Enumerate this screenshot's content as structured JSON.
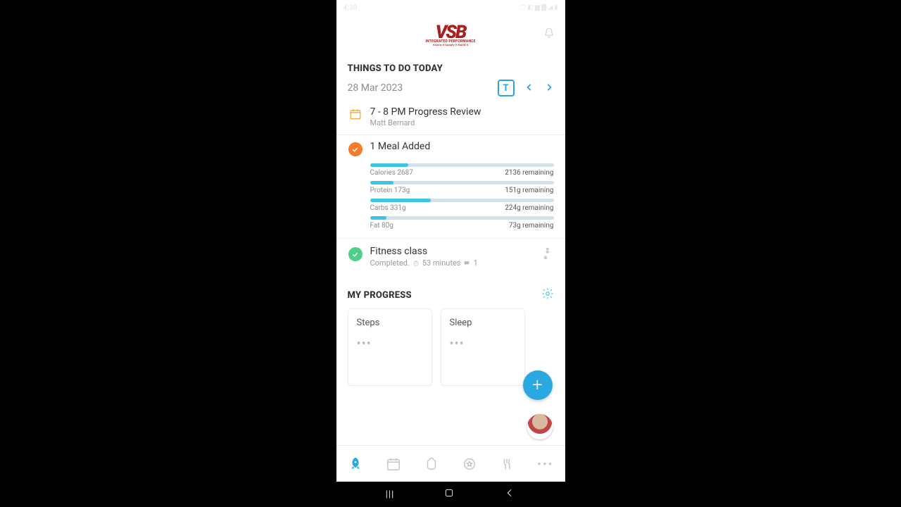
{
  "status": {
    "time": "4:30",
    "carrier": ""
  },
  "logo": {
    "brand": "VSB",
    "line1": "INTEGRATED PERFORMANCE",
    "line2": "Vision It  Supply It  Build It"
  },
  "todo": {
    "title": "THINGS TO DO TODAY",
    "date": "28 Mar 2023",
    "today_btn": "T",
    "event": {
      "title": "7 - 8 PM Progress Review",
      "sub": "Matt Bernard"
    },
    "meal": {
      "title": "1 Meal Added",
      "rows": [
        {
          "label": "Calories 2687",
          "remaining": "2136 remaining",
          "pct": 21
        },
        {
          "label": "Protein 173g",
          "remaining": "151g remaining",
          "pct": 13
        },
        {
          "label": "Carbs 331g",
          "remaining": "224g remaining",
          "pct": 33
        },
        {
          "label": "Fat 80g",
          "remaining": "73g remaining",
          "pct": 9
        }
      ]
    },
    "fitness": {
      "title": "Fitness class",
      "status": "Completed.",
      "duration": "53 minutes",
      "comments": "1"
    }
  },
  "progress": {
    "title": "MY PROGRESS",
    "cards": [
      {
        "title": "Steps"
      },
      {
        "title": "Sleep"
      }
    ]
  }
}
